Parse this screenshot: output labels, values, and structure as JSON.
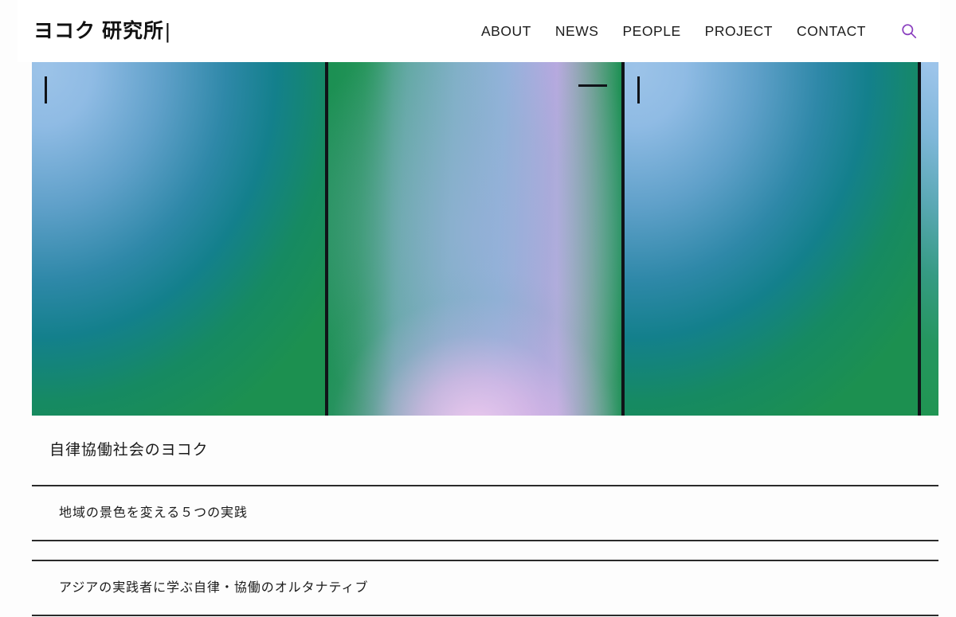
{
  "site": {
    "brand_name": "ヨコク 研究所",
    "brand_cursor": "|",
    "accent_color": "#8a3fbf",
    "rule_color": "#2b2b2b",
    "background_color": "#fdfdfd"
  },
  "header": {
    "nav_items": [
      {
        "label": "ABOUT"
      },
      {
        "label": "NEWS"
      },
      {
        "label": "PEOPLE"
      },
      {
        "label": "PROJECT"
      },
      {
        "label": "CONTACT"
      }
    ],
    "search": {
      "icon": "search-icon",
      "label": "検索"
    }
  },
  "hero": {
    "slides": [
      {
        "id": "slide-1",
        "gradient": "grad-bluegreen",
        "mark": "vertical-bar",
        "colors": [
          "#9cc3e8",
          "#13808c",
          "#1c9050"
        ]
      },
      {
        "id": "slide-2",
        "gradient": "grad-greenpink",
        "mark": "horizontal-dash",
        "colors": [
          "#1d9153",
          "#93b3dc",
          "#f0d9f2"
        ]
      },
      {
        "id": "slide-3",
        "gradient": "grad-bluegreen",
        "mark": "vertical-bar",
        "colors": [
          "#9cc3e8",
          "#13808c",
          "#1c9050"
        ]
      },
      {
        "id": "slide-4",
        "gradient": "grad-bluegreen-diag",
        "mark": "horizontal-dash",
        "colors": [
          "#a7cbee",
          "#369b84",
          "#209552"
        ]
      }
    ]
  },
  "main": {
    "section_title": "自律協働社会のヨコク",
    "articles": [
      {
        "title": "地域の景色を変える５つの実践"
      },
      {
        "title": "アジアの実践者に学ぶ自律・協働のオルタナティブ"
      }
    ]
  }
}
